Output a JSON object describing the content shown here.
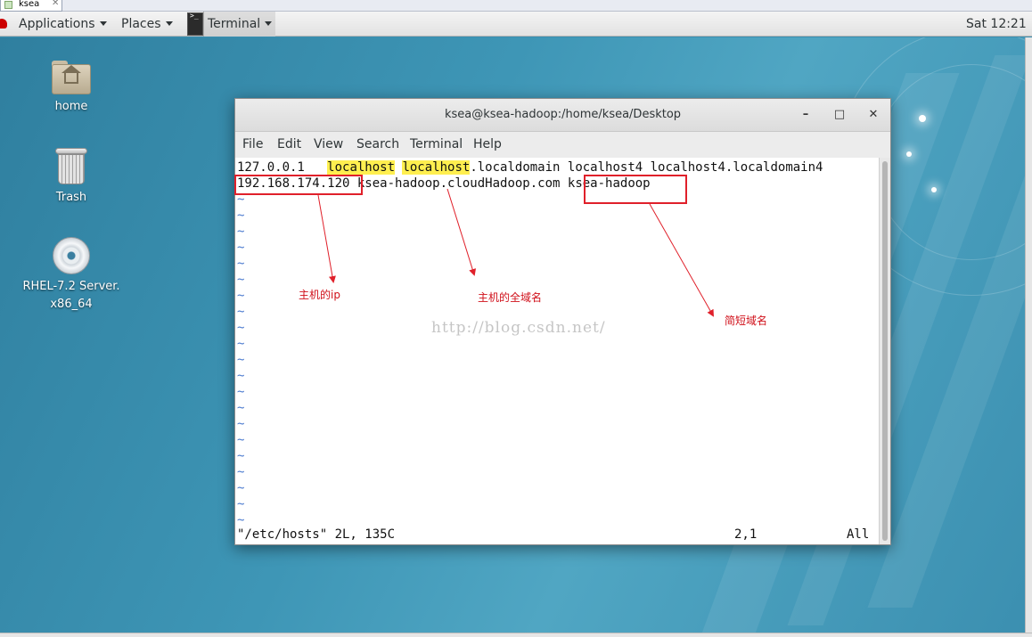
{
  "vm_tab": {
    "label": "ksea"
  },
  "panel": {
    "applications": "Applications",
    "places": "Places",
    "terminal": "Terminal",
    "clock": "Sat 12:21"
  },
  "desktop_icons": [
    {
      "label": "home"
    },
    {
      "label": "Trash"
    },
    {
      "label_line1": "RHEL-7.2 Server.",
      "label_line2": "x86_64"
    }
  ],
  "window": {
    "title": "ksea@ksea-hadoop:/home/ksea/Desktop",
    "menus": [
      "File",
      "Edit",
      "View",
      "Search",
      "Terminal",
      "Help"
    ]
  },
  "editor": {
    "line1": {
      "ip": "127.0.0.1",
      "hl1": "localhost",
      "hl2": "localhost",
      "rest": ".localdomain localhost4 localhost4.localdomain4"
    },
    "line2": {
      "ip": "192.168.174.120",
      "fqdn": "ksea-hadoop.cloudHadoop.com",
      "short": "ksea-hadoop"
    },
    "tilde": "~",
    "status_file": "\"/etc/hosts\" 2L, 135C",
    "status_pos": "2,1",
    "status_scope": "All"
  },
  "annotations": {
    "ip_label": "主机的ip",
    "fqdn_label": "主机的全域名",
    "short_label": "简短域名",
    "color": "#e0202a"
  },
  "watermark": "http://blog.csdn.net/"
}
